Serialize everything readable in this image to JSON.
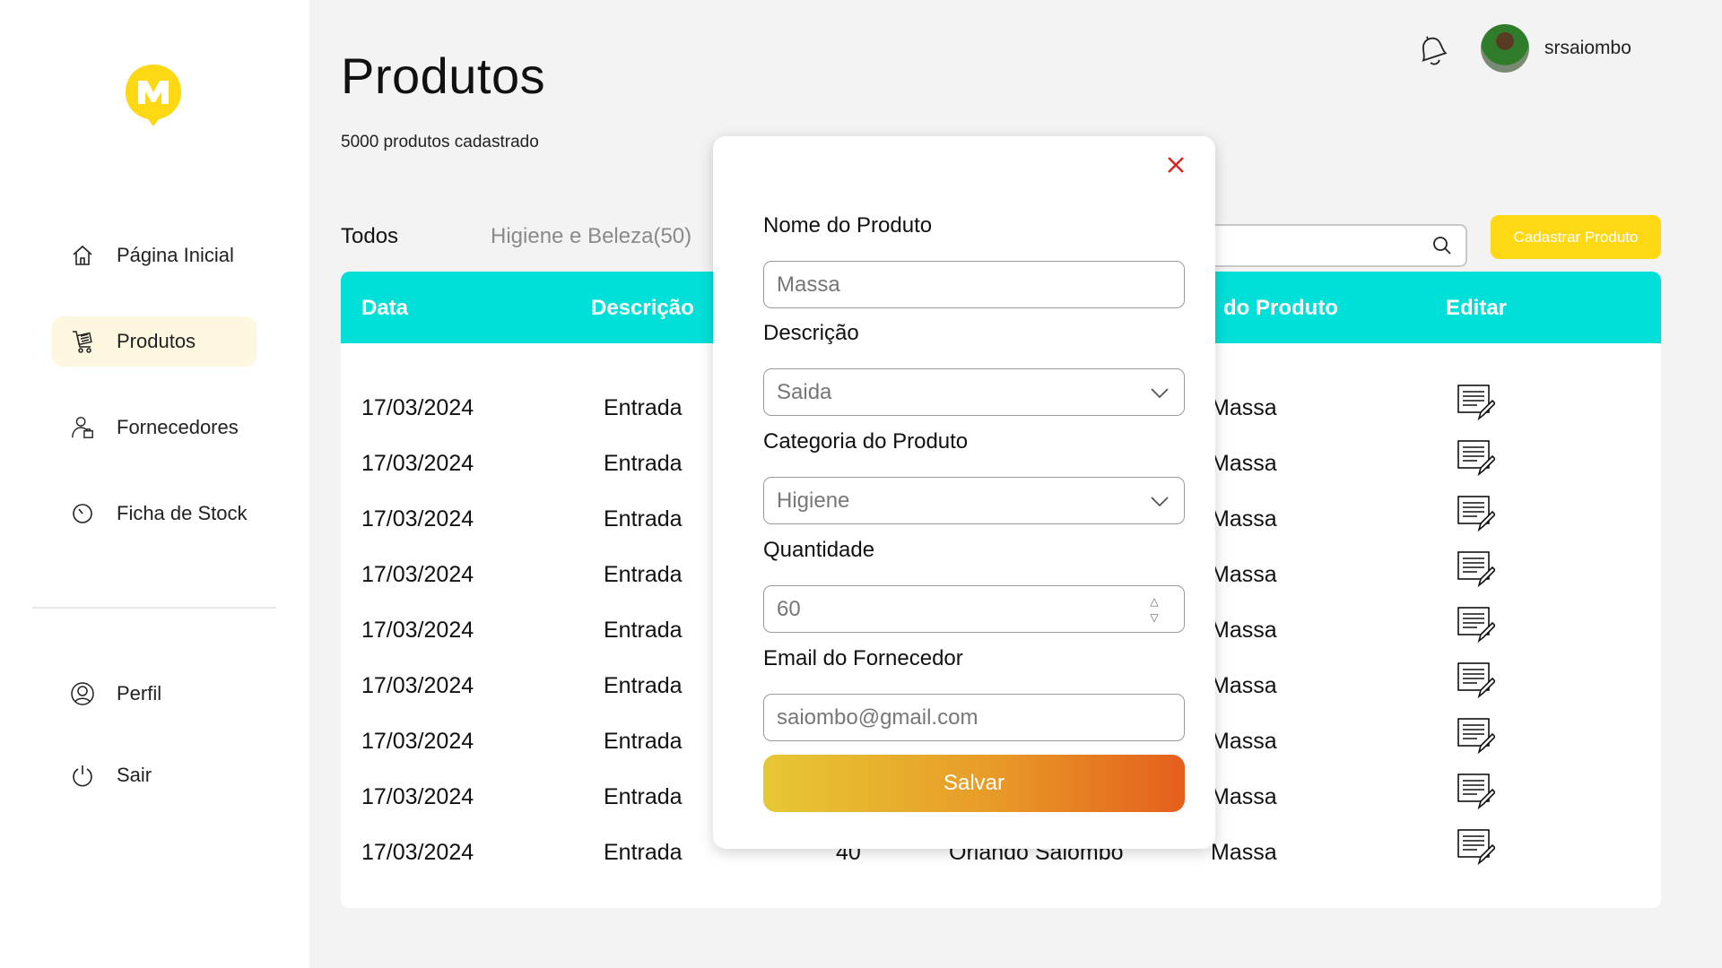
{
  "sidebar": {
    "items": [
      {
        "label": "Página Inicial",
        "icon": "home-icon"
      },
      {
        "label": "Produtos",
        "icon": "cart-icon"
      },
      {
        "label": "Fornecedores",
        "icon": "supplier-icon"
      },
      {
        "label": "Ficha de Stock",
        "icon": "clock-icon"
      }
    ],
    "bottom": [
      {
        "label": "Perfil",
        "icon": "user-icon"
      },
      {
        "label": "Sair",
        "icon": "power-icon"
      }
    ],
    "active_color": "#fdf7df",
    "logo_color": "#ffd814"
  },
  "header": {
    "title": "Produtos",
    "subtitle": "5000 produtos cadastrado",
    "username": "srsaiombo"
  },
  "tabs": [
    "Todos",
    "Higiene e Beleza(50)"
  ],
  "actions": {
    "cadastrar": "Cadastrar Produto"
  },
  "table": {
    "header_color": "#00dfd8",
    "columns": [
      "Data",
      "Descrição",
      "do Produto",
      "Editar"
    ],
    "rows": [
      {
        "data": "17/03/2024",
        "descricao": "Entrada",
        "produto": "Massa"
      },
      {
        "data": "17/03/2024",
        "descricao": "Entrada",
        "produto": "Massa"
      },
      {
        "data": "17/03/2024",
        "descricao": "Entrada",
        "produto": "Massa"
      },
      {
        "data": "17/03/2024",
        "descricao": "Entrada",
        "produto": "Massa"
      },
      {
        "data": "17/03/2024",
        "descricao": "Entrada",
        "produto": "Massa"
      },
      {
        "data": "17/03/2024",
        "descricao": "Entrada",
        "produto": "Massa"
      },
      {
        "data": "17/03/2024",
        "descricao": "Entrada",
        "produto": "Massa"
      },
      {
        "data": "17/03/2024",
        "descricao": "Entrada",
        "produto": "Massa"
      },
      {
        "data": "17/03/2024",
        "descricao": "Entrada",
        "produto": "Massa",
        "quantidade": "40",
        "fornecedor": "Orlando Saiombo"
      }
    ]
  },
  "modal": {
    "fields": [
      {
        "label": "Nome do Produto",
        "value": "Massa",
        "type": "text"
      },
      {
        "label": "Descrição",
        "value": "Saida",
        "type": "select"
      },
      {
        "label": "Categoria do Produto",
        "value": "Higiene",
        "type": "select"
      },
      {
        "label": "Quantidade",
        "value": "60",
        "type": "number"
      },
      {
        "label": "Email do Fornecedor",
        "value": "saiombo@gmail.com",
        "type": "email"
      }
    ],
    "save_label": "Salvar",
    "close_color": "#e02020"
  }
}
